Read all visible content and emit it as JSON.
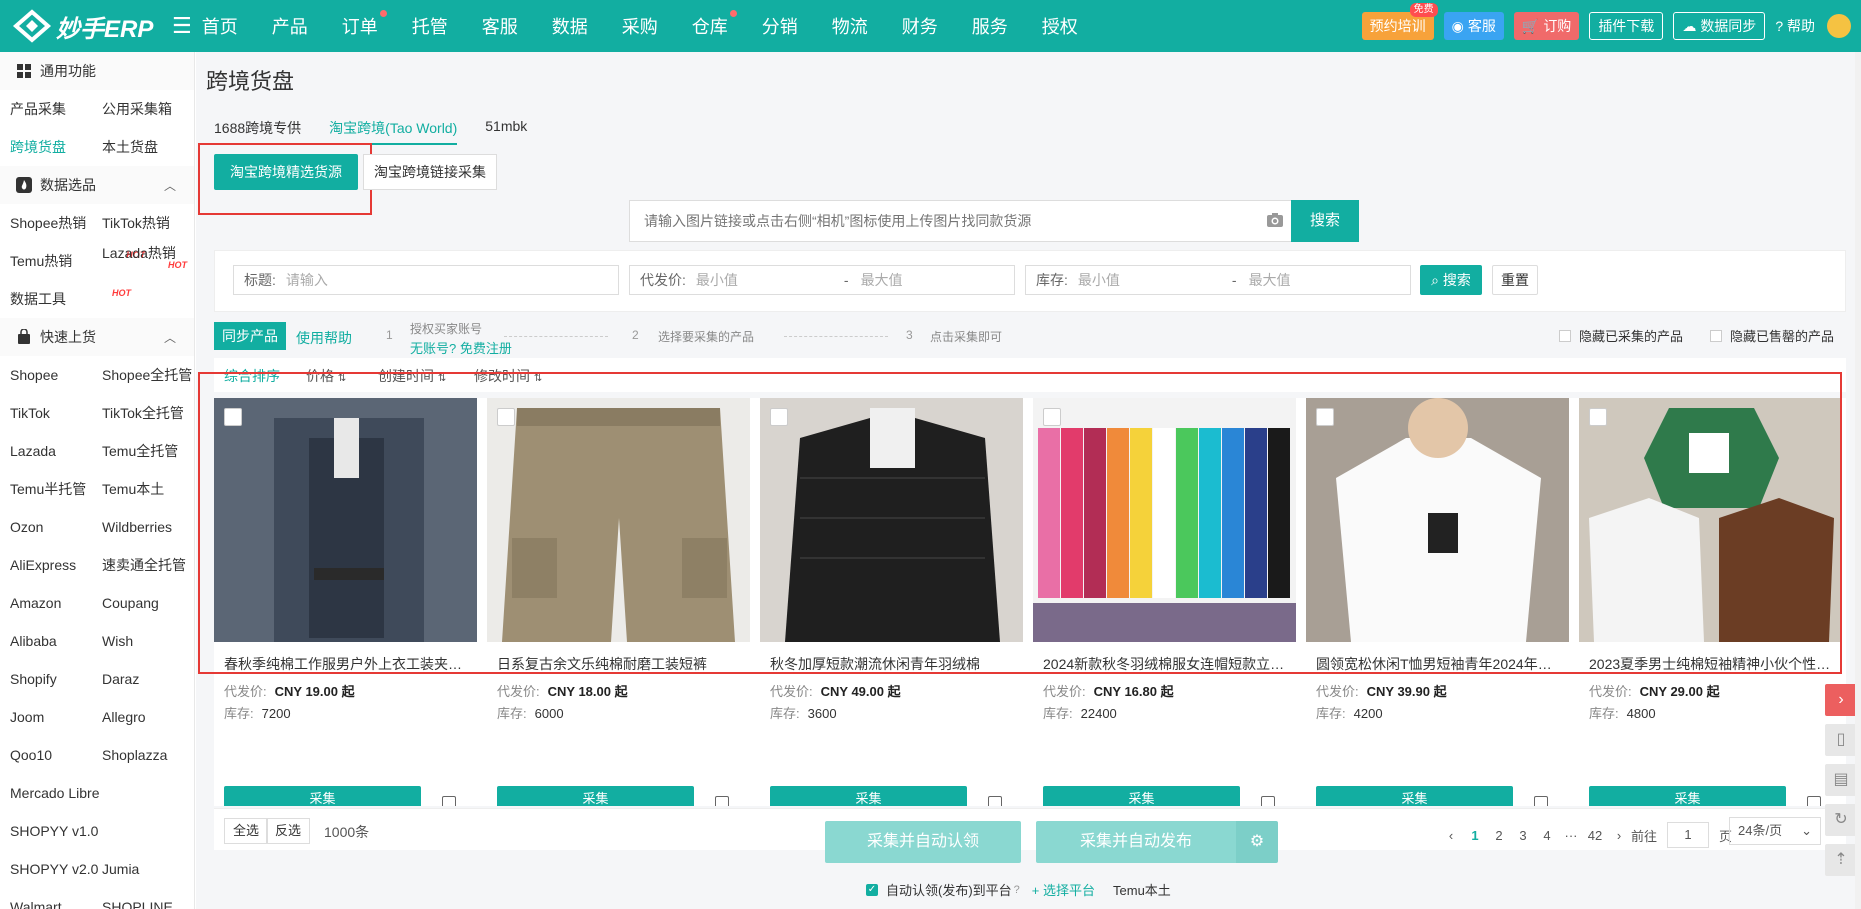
{
  "app": {
    "logo_text": "妙手ERP"
  },
  "topnav": {
    "items": [
      "首页",
      "产品",
      "订单",
      "托管",
      "客服",
      "数据",
      "采购",
      "仓库",
      "分销",
      "物流",
      "财务",
      "服务",
      "授权"
    ],
    "buttons": {
      "training": "预约培训",
      "training_badge": "免费",
      "service": "客服",
      "order": "订购",
      "plugin": "插件下载",
      "sync": "数据同步",
      "help": "帮助"
    }
  },
  "sidebar": {
    "common_title": "通用功能",
    "common_rows": [
      [
        "产品采集",
        "公用采集箱"
      ],
      [
        "跨境货盘",
        "本土货盘"
      ]
    ],
    "data_title": "数据选品",
    "data_rows": [
      [
        "Shopee热销",
        "TikTok热销"
      ],
      [
        "Temu热销",
        "Lazada热销"
      ],
      [
        "数据工具",
        ""
      ]
    ],
    "hot_label": "HOT",
    "quick_title": "快速上货",
    "quick_rows": [
      [
        "Shopee",
        "Shopee全托管"
      ],
      [
        "TikTok",
        "TikTok全托管"
      ],
      [
        "Lazada",
        "Temu全托管"
      ],
      [
        "Temu半托管",
        "Temu本土"
      ],
      [
        "Ozon",
        "Wildberries"
      ],
      [
        "AliExpress",
        "速卖通全托管"
      ],
      [
        "Amazon",
        "Coupang"
      ],
      [
        "Alibaba",
        "Wish"
      ],
      [
        "Shopify",
        "Daraz"
      ],
      [
        "Joom",
        "Allegro"
      ],
      [
        "Qoo10",
        "Shoplazza"
      ],
      [
        "Mercado Libre",
        ""
      ],
      [
        "SHOPYY v1.0",
        ""
      ],
      [
        "SHOPYY v2.0",
        "Jumia"
      ],
      [
        "Walmart",
        "SHOPLINE"
      ]
    ]
  },
  "page": {
    "title": "跨境货盘",
    "tabs": [
      "1688跨境专供",
      "淘宝跨境(Tao World)",
      "51mbk"
    ],
    "subtab_active": "淘宝跨境精选货源",
    "subtab_other": "淘宝跨境链接采集",
    "image_search_placeholder": "请输入图片链接或点击右侧“相机”图标使用上传图片找同款货源",
    "image_search_button": "搜索"
  },
  "filters": {
    "title_label": "标题:",
    "title_placeholder": "请输入",
    "price_label": "代发价:",
    "stock_label": "库存:",
    "min_placeholder": "最小值",
    "max_placeholder": "最大值",
    "search": "搜索",
    "reset": "重置"
  },
  "steps": {
    "sync": "同步产品",
    "help": "使用帮助",
    "s1_num": "1",
    "s1_text": "授权买家账号",
    "s1_link": "无账号? 免费注册",
    "s2_num": "2",
    "s2_text": "选择要采集的产品",
    "s3_num": "3",
    "s3_text": "点击采集即可",
    "hide_collected": "隐藏已采集的产品",
    "hide_soldout": "隐藏已售罄的产品"
  },
  "sort": [
    "综合排序",
    "价格",
    "创建时间",
    "修改时间"
  ],
  "products": [
    {
      "title": "春秋季纯棉工作服男户外上衣工装夹克...",
      "price_label": "代发价:",
      "price": "CNY 19.00 起",
      "stock_label": "库存:",
      "stock": "7200",
      "button": "采集"
    },
    {
      "title": "日系复古余文乐纯棉耐磨工装短裤",
      "price_label": "代发价:",
      "price": "CNY 18.00 起",
      "stock_label": "库存:",
      "stock": "6000",
      "button": "采集"
    },
    {
      "title": "秋冬加厚短款潮流休闲青年羽绒棉",
      "price_label": "代发价:",
      "price": "CNY 49.00 起",
      "stock_label": "库存:",
      "stock": "3600",
      "button": "采集"
    },
    {
      "title": "2024新款秋冬羽绒棉服女连帽短款立领...",
      "price_label": "代发价:",
      "price": "CNY 16.80 起",
      "stock_label": "库存:",
      "stock": "22400",
      "button": "采集"
    },
    {
      "title": "圆领宽松休闲T恤男短袖青年2024年夏...",
      "price_label": "代发价:",
      "price": "CNY 39.90 起",
      "stock_label": "库存:",
      "stock": "4200",
      "button": "采集"
    },
    {
      "title": "2023夏季男士纯棉短袖精神小伙个性帅...",
      "price_label": "代发价:",
      "price": "CNY 29.00 起",
      "stock_label": "库存:",
      "stock": "4800",
      "button": "采集"
    }
  ],
  "pagination": {
    "select_all": "全选",
    "invert": "反选",
    "total": "1000条",
    "pages": [
      "1",
      "2",
      "3",
      "4",
      "···",
      "42"
    ],
    "goto_label": "前往",
    "goto_value": "1",
    "page_unit": "页",
    "page_size": "24条/页"
  },
  "actions": {
    "claim": "采集并自动认领",
    "publish": "采集并自动发布",
    "auto_label": "自动认领(发布)到平台",
    "select_platform": "+ 选择平台",
    "platform": "Temu本土"
  },
  "colors": {
    "primary": "#12aea1",
    "highlight": "#e53935"
  }
}
